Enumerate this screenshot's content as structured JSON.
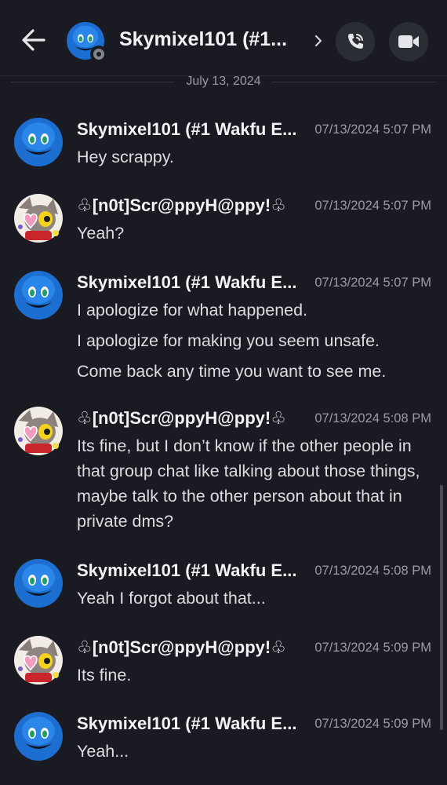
{
  "header": {
    "title": "Skymixel101 (#1...",
    "back_icon": "arrow-left-icon",
    "call_icon": "phone-call-icon",
    "video_icon": "video-camera-icon"
  },
  "date_divider": "July 13, 2024",
  "messages": [
    {
      "author": "Skymixel101 (#1 Wakfu E...",
      "time": "07/13/2024 5:07 PM",
      "lines": [
        "Hey scrappy."
      ]
    },
    {
      "author": "♧[n0t]Scr@ppyH@ppy!♧",
      "time": "07/13/2024 5:07 PM",
      "lines": [
        "Yeah?"
      ]
    },
    {
      "author": "Skymixel101 (#1 Wakfu E...",
      "time": "07/13/2024 5:07 PM",
      "lines": [
        "I apologize for what happened.",
        "I apologize for making you seem unsafe.",
        "Come back any time you want to see me."
      ]
    },
    {
      "author": "♧[n0t]Scr@ppyH@ppy!♧",
      "time": "07/13/2024 5:08 PM",
      "lines": [
        "Its fine, but I don’t know if the other people in that group chat like talking about those things, maybe talk to the other person about that in private dms?"
      ]
    },
    {
      "author": "Skymixel101 (#1 Wakfu E...",
      "time": "07/13/2024 5:08 PM",
      "lines": [
        "Yeah I forgot about that..."
      ]
    },
    {
      "author": "♧[n0t]Scr@ppyH@ppy!♧",
      "time": "07/13/2024 5:09 PM",
      "lines": [
        "Its fine."
      ]
    },
    {
      "author": "Skymixel101 (#1 Wakfu E...",
      "time": "07/13/2024 5:09 PM",
      "lines": [
        "Yeah..."
      ]
    }
  ]
}
